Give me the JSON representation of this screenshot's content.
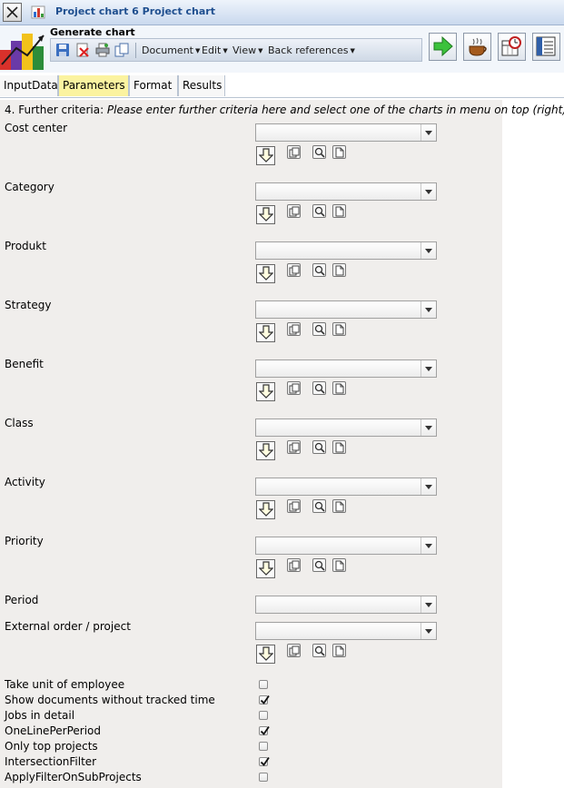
{
  "window": {
    "title": "Project chart 6 Project chart"
  },
  "toolbar": {
    "generate_label": "Generate chart",
    "menus": [
      "Document",
      "Edit",
      "View",
      "Back references"
    ]
  },
  "tabs": [
    "InputData",
    "Parameters",
    "Format",
    "Results"
  ],
  "active_tab": "Parameters",
  "form": {
    "heading_prefix": "4. Further criteria: ",
    "heading_hint": "Please enter further criteria here and select one of the charts in menu on top (right)",
    "fields": [
      {
        "label": "Cost center",
        "value": ""
      },
      {
        "label": "Category",
        "value": ""
      },
      {
        "label": "Produkt",
        "value": ""
      },
      {
        "label": "Strategy",
        "value": ""
      },
      {
        "label": "Benefit",
        "value": ""
      },
      {
        "label": "Class",
        "value": ""
      },
      {
        "label": "Activity",
        "value": ""
      },
      {
        "label": "Priority",
        "value": ""
      },
      {
        "label": "Period",
        "value": ""
      },
      {
        "label": "External order / project",
        "value": ""
      }
    ],
    "options": [
      {
        "label": "Take unit of employee",
        "checked": false
      },
      {
        "label": "Show documents without tracked time",
        "checked": true
      },
      {
        "label": "Jobs in detail",
        "checked": false
      },
      {
        "label": "OneLinePerPeriod",
        "checked": true
      },
      {
        "label": "Only top projects",
        "checked": false
      },
      {
        "label": "IntersectionFilter",
        "checked": true
      },
      {
        "label": "ApplyFilterOnSubProjects",
        "checked": false
      }
    ]
  },
  "colors": {
    "active_tab": "#fbf3a0",
    "panel": "#f0eeec",
    "title_text": "#1f4f8f"
  }
}
